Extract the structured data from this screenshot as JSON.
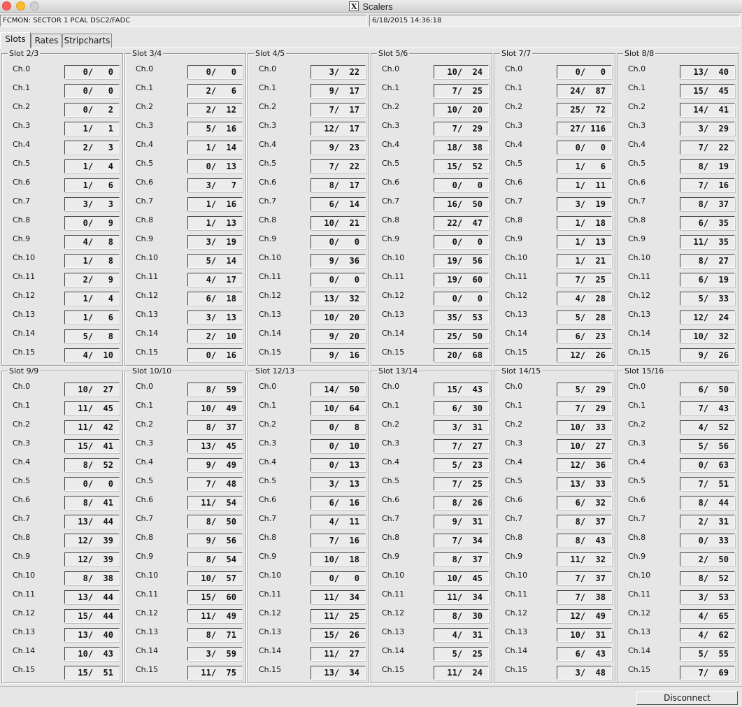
{
  "window": {
    "title": "Scalers"
  },
  "header": {
    "left": "FCMON: SECTOR 1 PCAL DSC2/FADC",
    "right": "6/18/2015 14:36:18"
  },
  "tabs": [
    {
      "label": "Slots",
      "active": true
    },
    {
      "label": "Rates",
      "active": false
    },
    {
      "label": "Stripcharts",
      "active": false
    }
  ],
  "slots": [
    {
      "title": "Slot 2/3",
      "values": [
        "0/ 0",
        "0/ 0",
        "0/ 2",
        "1/ 1",
        "2/ 3",
        "1/ 4",
        "1/ 6",
        "3/ 3",
        "0/ 9",
        "4/ 8",
        "1/ 8",
        "2/ 9",
        "1/ 4",
        "1/ 6",
        "5/ 8",
        "4/ 10"
      ]
    },
    {
      "title": "Slot 3/4",
      "values": [
        "0/ 0",
        "2/ 6",
        "2/ 12",
        "5/ 16",
        "1/ 14",
        "0/ 13",
        "3/ 7",
        "1/ 16",
        "1/ 13",
        "3/ 19",
        "5/ 14",
        "4/ 17",
        "6/ 18",
        "3/ 13",
        "2/ 10",
        "0/ 16"
      ]
    },
    {
      "title": "Slot 4/5",
      "values": [
        "3/ 22",
        "9/ 17",
        "7/ 17",
        "12/ 17",
        "9/ 23",
        "7/ 22",
        "8/ 17",
        "6/ 14",
        "10/ 21",
        "0/ 0",
        "9/ 36",
        "0/ 0",
        "13/ 32",
        "10/ 20",
        "9/ 20",
        "9/ 16"
      ]
    },
    {
      "title": "Slot 5/6",
      "values": [
        "10/ 24",
        "7/ 25",
        "10/ 20",
        "7/ 29",
        "18/ 38",
        "15/ 52",
        "0/ 0",
        "16/ 50",
        "22/ 47",
        "0/ 0",
        "19/ 56",
        "19/ 60",
        "0/ 0",
        "35/ 53",
        "25/ 50",
        "20/ 68"
      ]
    },
    {
      "title": "Slot 7/7",
      "values": [
        "0/ 0",
        "24/ 87",
        "25/ 72",
        "27/ 116",
        "0/ 0",
        "1/ 6",
        "1/ 11",
        "3/ 19",
        "1/ 18",
        "1/ 13",
        "1/ 21",
        "7/ 25",
        "4/ 28",
        "5/ 28",
        "6/ 23",
        "12/ 26"
      ]
    },
    {
      "title": "Slot 8/8",
      "values": [
        "13/ 40",
        "15/ 45",
        "14/ 41",
        "3/ 29",
        "7/ 22",
        "8/ 19",
        "7/ 16",
        "8/ 37",
        "6/ 35",
        "11/ 35",
        "8/ 27",
        "6/ 19",
        "5/ 33",
        "12/ 24",
        "10/ 32",
        "9/ 26"
      ]
    },
    {
      "title": "Slot 9/9",
      "values": [
        "10/ 27",
        "11/ 45",
        "11/ 42",
        "15/ 41",
        "8/ 52",
        "0/ 0",
        "8/ 41",
        "13/ 44",
        "12/ 39",
        "12/ 39",
        "8/ 38",
        "13/ 44",
        "15/ 44",
        "13/ 40",
        "10/ 43",
        "15/ 51"
      ]
    },
    {
      "title": "Slot 10/10",
      "values": [
        "8/ 59",
        "10/ 49",
        "8/ 37",
        "13/ 45",
        "9/ 49",
        "7/ 48",
        "11/ 54",
        "8/ 50",
        "9/ 56",
        "8/ 54",
        "10/ 57",
        "15/ 60",
        "11/ 49",
        "8/ 71",
        "3/ 59",
        "11/ 75"
      ]
    },
    {
      "title": "Slot 12/13",
      "values": [
        "14/ 50",
        "10/ 64",
        "0/ 8",
        "0/ 10",
        "0/ 13",
        "3/ 13",
        "6/ 16",
        "4/ 11",
        "7/ 16",
        "10/ 18",
        "0/ 0",
        "11/ 34",
        "11/ 25",
        "15/ 26",
        "11/ 27",
        "13/ 34"
      ]
    },
    {
      "title": "Slot 13/14",
      "values": [
        "15/ 43",
        "6/ 30",
        "3/ 31",
        "7/ 27",
        "5/ 23",
        "7/ 25",
        "8/ 26",
        "9/ 31",
        "7/ 34",
        "8/ 37",
        "10/ 45",
        "11/ 34",
        "8/ 30",
        "4/ 31",
        "5/ 25",
        "11/ 24"
      ]
    },
    {
      "title": "Slot 14/15",
      "values": [
        "5/ 29",
        "7/ 29",
        "10/ 33",
        "10/ 27",
        "12/ 36",
        "13/ 33",
        "6/ 32",
        "8/ 37",
        "8/ 43",
        "11/ 32",
        "7/ 37",
        "7/ 38",
        "12/ 49",
        "10/ 31",
        "6/ 43",
        "3/ 48"
      ]
    },
    {
      "title": "Slot 15/16",
      "values": [
        "6/ 50",
        "7/ 43",
        "4/ 52",
        "5/ 56",
        "0/ 63",
        "7/ 51",
        "8/ 44",
        "2/ 31",
        "0/ 33",
        "2/ 50",
        "8/ 52",
        "3/ 53",
        "4/ 65",
        "4/ 62",
        "5/ 55",
        "7/ 69"
      ]
    }
  ],
  "channel_labels": [
    "Ch.0",
    "Ch.1",
    "Ch.2",
    "Ch.3",
    "Ch.4",
    "Ch.5",
    "Ch.6",
    "Ch.7",
    "Ch.8",
    "Ch.9",
    "Ch.10",
    "Ch.11",
    "Ch.12",
    "Ch.13",
    "Ch.14",
    "Ch.15"
  ],
  "footer": {
    "disconnect_label": "Disconnect"
  },
  "colors": {
    "background": "#e6e6e6",
    "close": "#fc5f57",
    "minimize": "#fdbc2e"
  }
}
